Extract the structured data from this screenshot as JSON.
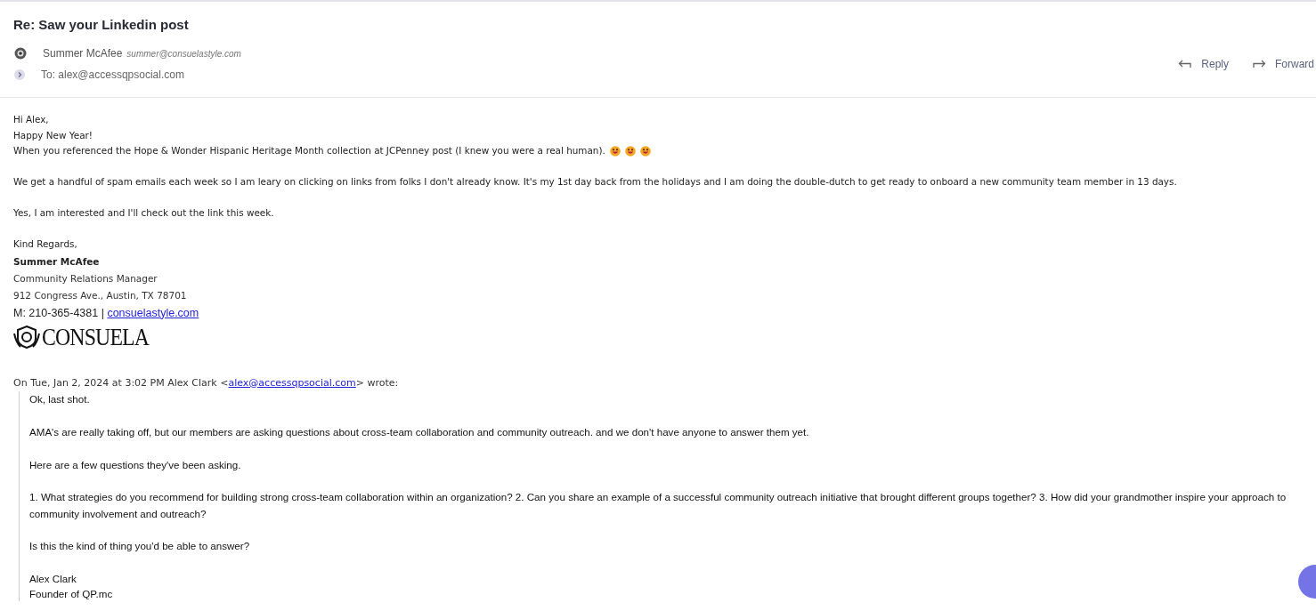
{
  "subject": "Re: Saw your Linkedin post",
  "sender": {
    "name": "Summer McAfee",
    "email": "summer@consuelastyle.com"
  },
  "recipient": "To: alex@accessqpsocial.com",
  "actions": [
    {
      "label": "Reply",
      "kind": "reply"
    },
    {
      "label": "Forward",
      "kind": "forward"
    }
  ],
  "greeting": [
    "Hi Alex,",
    "Happy New Year!"
  ],
  "reaction_line": "When you referenced the Hope & Wonder Hispanic Heritage Month collection at JCPenney post (I knew you were a real human).",
  "paragraphs": [
    "We get a handful of spam emails each week so I am leary on clicking on links from folks I don't already know. It's my 1st day back from the holidays and I am doing the double-dutch to get ready to onboard a new community team member in 13 days.",
    "Yes, I am interested and I'll check out the link this week."
  ],
  "signature": {
    "closing": "Kind Regards,",
    "name": "Summer McAfee",
    "title": "Community Relations Manager",
    "address": "912 Congress Ave., Austin, TX 78701",
    "phone": "M: 210-365-4381 | ",
    "website": "consuelastyle.com",
    "logo": "CONSUELA"
  },
  "quote_header": {
    "before": "On Tue, Jan 2, 2024 at 3:02 PM Alex Clark <",
    "link": "alex@accessqpsocial.com",
    "after": "> wrote:"
  },
  "quote": [
    "Ok, last shot.",
    "AMA's are really taking off, but our members are asking questions about cross-team collaboration and community outreach. and we don't have anyone to answer them yet.",
    "Here are a few questions they've been asking.",
    "1. What strategies do you recommend for building strong cross-team collaboration within an organization? 2. Can you share an example of a successful community outreach initiative that brought different groups together? 3. How did your grandmother inspire your approach to community involvement and outreach?",
    "Is this the kind of thing you'd be able to answer?"
  ],
  "quote_signature": [
    "Alex Clark",
    "Founder of QP.mc"
  ]
}
